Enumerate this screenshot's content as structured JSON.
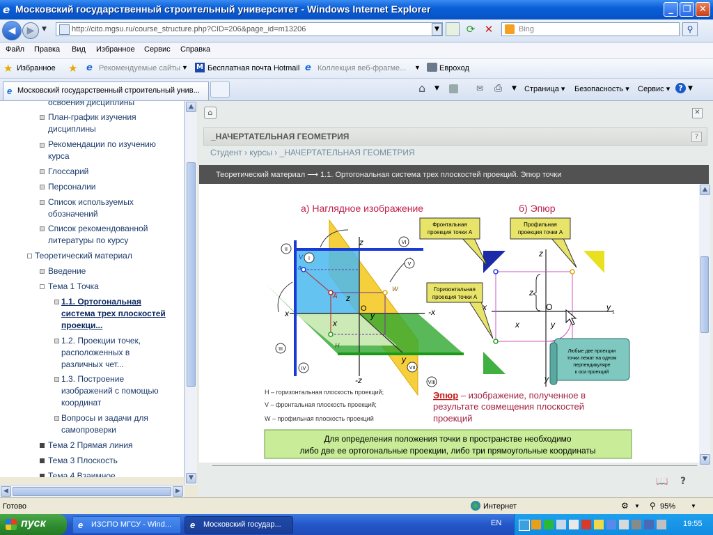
{
  "window": {
    "title": "Московский государственный строительный университет - Windows Internet Explorer"
  },
  "address_bar": {
    "url": "http://cito.mgsu.ru/course_structure.php?CID=206&page_id=m13206",
    "search_placeholder": "Bing"
  },
  "menu": [
    "Файл",
    "Правка",
    "Вид",
    "Избранное",
    "Сервис",
    "Справка"
  ],
  "favorites_bar": {
    "favorites_label": "Избранное",
    "links": [
      "Рекомендуемые сайты",
      "Бесплатная почта Hotmail",
      "Коллекция веб-фрагме...",
      "Евроход"
    ]
  },
  "tab": {
    "title": "Московский государственный строительный унив..."
  },
  "command_bar": {
    "page": "Страница",
    "safety": "Безопасность",
    "tools": "Сервис"
  },
  "sidebar": {
    "items": [
      {
        "text": "освоения дисциплины"
      },
      {
        "text": "План-график изучения дисциплины"
      },
      {
        "text": "Рекомендации по изучению курса"
      },
      {
        "text": "Глоссарий"
      },
      {
        "text": "Персоналии"
      },
      {
        "text": "Список используемых обозначений"
      },
      {
        "text": "Список рекомендованной литературы по курсу"
      },
      {
        "text": "Теоретический материал"
      },
      {
        "text": "Введение"
      },
      {
        "text": "Тема 1 Точка"
      },
      {
        "text": "1.1. Ортогональная система трех плоскостей проекци..."
      },
      {
        "text": "1.2. Проекции точек, расположенных в различных чет..."
      },
      {
        "text": "1.3. Построение изображений с помощью координат"
      },
      {
        "text": "Вопросы и задачи для самопроверки"
      },
      {
        "text": "Тема 2 Прямая линия"
      },
      {
        "text": "Тема 3 Плоскость"
      },
      {
        "text": "Тема 4 Взаимное"
      }
    ]
  },
  "content": {
    "course_title": "_НАЧЕРТАТЕЛЬНАЯ ГЕОМЕТРИЯ",
    "breadcrumbs": [
      "Студент",
      "курсы",
      "_НАЧЕРТАТЕЛЬНАЯ ГЕОМЕТРИЯ"
    ],
    "breadcrumb_sep": "›",
    "section_bar": "Теоретический материал ⟶ 1.1. Ортогональная система трех плоскостей проекций. Эпюр точки"
  },
  "diagram": {
    "title_a": "а) Наглядное изображение",
    "title_b": "б) Эпюр",
    "callout_frontal": [
      "Фронтальная",
      "проекция точки А"
    ],
    "callout_profile": [
      "Профильная",
      "проекция точки А"
    ],
    "callout_horizontal": [
      "Горизонтальная",
      "проекция точки А"
    ],
    "callout_note": [
      "Любые две проекции",
      "точки лежат на одном",
      "перпендикуляре",
      "к оси проекций"
    ],
    "legend_h": "H – горизонтальная плоскость проекций;",
    "legend_v": "V – фронтальная плоскость проекций;",
    "legend_w": "W – профильная плоскость проекций",
    "epure_term": "Эпюр",
    "epure_def": [
      " – изображение, полученное в",
      "результате совмещения плоскостей",
      "проекций"
    ],
    "box_text": [
      "Для определения положения точки в пространстве необходимо",
      "либо две ее ортогональные проекции, либо три прямоугольные координаты"
    ],
    "roman": [
      "II",
      "I",
      "VI",
      "V",
      "III",
      "IV",
      "VII",
      "VIII"
    ],
    "labels": {
      "z": "z",
      "x": "x",
      "y": "y",
      "minus_x": "-x",
      "minus_z": "-z",
      "O": "O",
      "y1": "y",
      "y1_sub": "1",
      "a": "a",
      "A": "A",
      "H": "H",
      "V": "V",
      "W": "W",
      "a1": "a",
      "a2": "a",
      "a1_sup": "'",
      "a2_sup": "''"
    }
  },
  "statusbar": {
    "status": "Готово",
    "zone": "Интернет",
    "zoom": "95%"
  },
  "taskbar": {
    "start": "пуск",
    "tasks": [
      "ИЗСПО МГСУ - Wind...",
      "Московский государ..."
    ],
    "lang": "EN",
    "time": "19:55"
  }
}
